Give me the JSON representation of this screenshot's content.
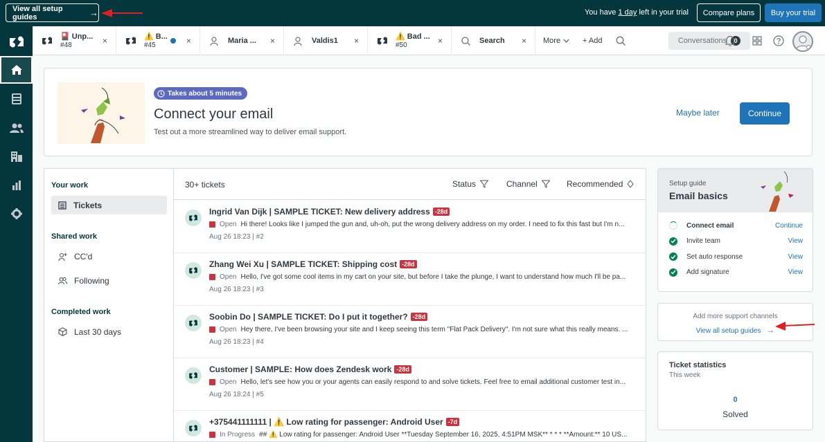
{
  "banner": {
    "guides_label": "View all setup guides",
    "guides_arrow": "→",
    "trial_prefix": "You have ",
    "trial_days": "1 day",
    "trial_suffix": " left in your trial",
    "compare_label": "Compare plans",
    "buy_label": "Buy your trial"
  },
  "tabs": [
    {
      "title": "🎴 Unp...",
      "sub": "#48",
      "close": "×",
      "icon": "zendesk-icon"
    },
    {
      "title": "⚠️ B...",
      "sub": "#45",
      "close": "×",
      "icon": "zendesk-icon"
    },
    {
      "title": "Maria ...",
      "sub": "",
      "close": "×",
      "icon": "user-icon"
    },
    {
      "title": "Valdis1",
      "sub": "",
      "close": "×",
      "icon": "user-icon"
    },
    {
      "title": "⚠️ Bad ...",
      "sub": "#50",
      "close": "×",
      "icon": "zendesk-icon"
    },
    {
      "title": "Search",
      "sub": "",
      "close": "×",
      "icon": "search-icon"
    }
  ],
  "toolbar": {
    "more_label": "More",
    "add_label": "+ Add",
    "conversations_label": "Conversations",
    "conversations_count": "0"
  },
  "email_card": {
    "pill_label": "Takes about 5 minutes",
    "title": "Connect your email",
    "subtitle": "Test out a more streamlined way to deliver email support.",
    "maybe_later": "Maybe later",
    "continue": "Continue"
  },
  "views": {
    "your_work": "Your work",
    "tickets": "Tickets",
    "shared_work": "Shared work",
    "ccd": "CC'd",
    "following": "Following",
    "completed_work": "Completed work",
    "last_30": "Last 30 days"
  },
  "ticket_list": {
    "count": "30+ tickets",
    "status_filter": "Status",
    "channel_filter": "Channel",
    "sort": "Recommended",
    "tickets": [
      {
        "title": "Ingrid Van Dijk | SAMPLE TICKET: New delivery address",
        "badge": "-28d",
        "status": "Open",
        "preview": "Hi there! Looks like I jumped the gun and, uh-oh, put the wrong delivery address on my order. I need to fix this fast but I'm n...",
        "meta": "Aug 26 18:23 | #2"
      },
      {
        "title": "Zhang Wei Xu | SAMPLE TICKET: Shipping cost",
        "badge": "-28d",
        "status": "Open",
        "preview": "Hello, I've got some cool items in my cart on your site, but before I take the plunge, I want to understand how much I'll be pa...",
        "meta": "Aug 26 18:23 | #3"
      },
      {
        "title": "Soobin Do | SAMPLE TICKET: Do I put it together?",
        "badge": "-28d",
        "status": "Open",
        "preview": "Hey there, I've been browsing your site and I keep seeing this term \"Flat Pack Delivery\". I'm not sure what this really means. ...",
        "meta": "Aug 26 18:23 | #4"
      },
      {
        "title": "Customer | SAMPLE: How does Zendesk work",
        "badge": "-28d",
        "status": "Open",
        "preview": "Hello, let's see how you or your agents can easily respond to and solve tickets. Feel free to email additional customer test in...",
        "meta": "Aug 26 18:24 | #5"
      },
      {
        "title": "+375441111111 | ⚠️ Low rating for passenger: Android User",
        "badge": "-7d",
        "status": "In Progress",
        "preview": "## ⚠️ Low rating for passenger: Android User **Tuesday September 16, 2025, 4:51PM MSK** * * * **Amount:** 10 US...",
        "meta": ""
      }
    ]
  },
  "setup_guide": {
    "label": "Setup guide",
    "title": "Email basics",
    "items": [
      {
        "label": "Connect email",
        "action": "Continue",
        "done": false
      },
      {
        "label": "Invite team",
        "action": "View",
        "done": true
      },
      {
        "label": "Set auto response",
        "action": "View",
        "done": true
      },
      {
        "label": "Add signature",
        "action": "View",
        "done": true
      }
    ]
  },
  "more_channels": {
    "text": "Add more support channels",
    "link": "View all setup guides",
    "arrow": "→"
  },
  "stats": {
    "title": "Ticket statistics",
    "period": "This week",
    "value": "0",
    "label": "Solved"
  },
  "colors": {
    "nav_bg": "#03363d",
    "accent": "#1f73b7",
    "badge": "#cc3340",
    "success": "#038153",
    "annotation_arrow": "#e02020"
  }
}
